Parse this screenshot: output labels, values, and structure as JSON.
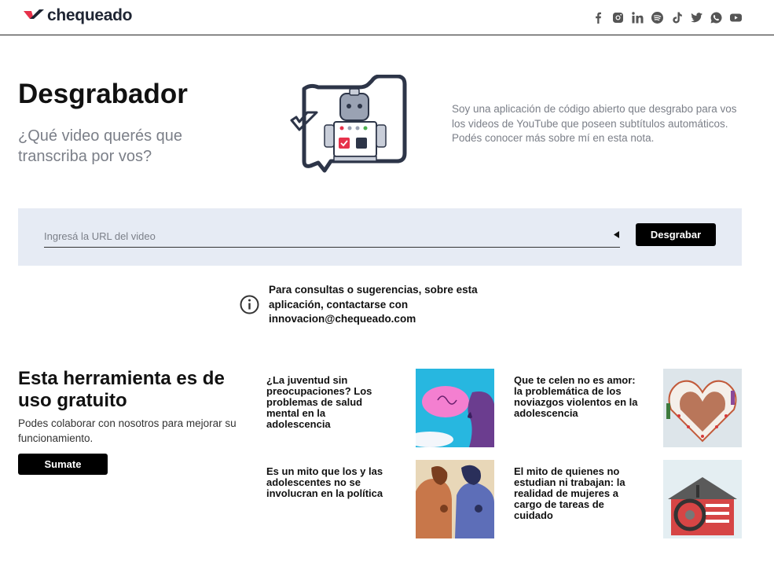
{
  "header": {
    "logo_text": "chequeado",
    "socials": [
      "facebook-icon",
      "instagram-icon",
      "linkedin-icon",
      "spotify-icon",
      "tiktok-icon",
      "twitter-icon",
      "whatsapp-icon",
      "youtube-icon"
    ]
  },
  "hero": {
    "title": "Desgrabador",
    "subtitle": "¿Qué video querés que transcriba por vos?",
    "intro": "Soy una aplicación de código abierto que desgrabo para vos los videos de YouTube que poseen subtítulos automáticos. Podés conocer más sobre mí en esta nota."
  },
  "url_form": {
    "placeholder": "Ingresá la URL del video",
    "value": "",
    "button_label": "Desgrabar"
  },
  "contact": {
    "text": "Para consultas o sugerencias, sobre esta aplicación, contactarse con innovacion@chequeado.com"
  },
  "free": {
    "title": "Esta herramienta es de uso gratuito",
    "description": "Podes colaborar con nosotros para mejorar su funcionamiento.",
    "button_label": "Sumate"
  },
  "articles": [
    {
      "title": "¿La juventud sin preocupaciones? Los problemas de salud mental en la adolescencia"
    },
    {
      "title": "Que te celen no es amor: la problemática de los noviazgos violentos en la adolescencia"
    },
    {
      "title": "Es un mito que los y las adolescentes no se involucran en la política"
    },
    {
      "title": "El mito de quienes no estudian ni trabajan: la realidad de mujeres a cargo de tareas de cuidado"
    }
  ],
  "colors": {
    "brand_red": "#e6324b",
    "brand_dark": "#1f2533",
    "panel_bg": "#e6ebf4",
    "muted_text": "#7b7f88"
  }
}
